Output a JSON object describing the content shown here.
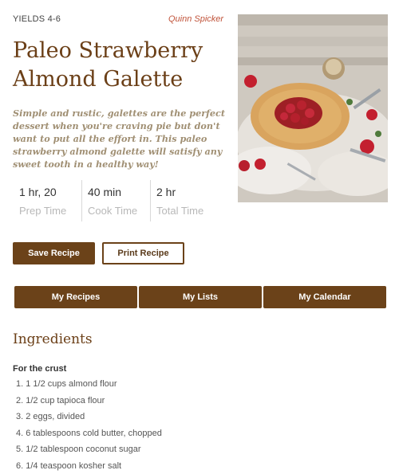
{
  "recipe": {
    "yields": "YIELDS 4-6",
    "author": "Quinn Spicker",
    "title_line1": "Paleo Strawberry",
    "title_line2": "Almond Galette",
    "description": "Simple and rustic, galettes are the perfect dessert when you're craving pie but don't want to put all the effort in. This paleo strawberry almond galette will satisfy any sweet tooth in a healthy way!"
  },
  "times": [
    {
      "value": "1 hr, 20",
      "label": "Prep Time"
    },
    {
      "value": "40 min",
      "label": "Cook Time"
    },
    {
      "value": "2 hr",
      "label": "Total Time"
    }
  ],
  "actions": {
    "save_label": "Save Recipe",
    "print_label": "Print Recipe"
  },
  "tabs": [
    {
      "label": "My Recipes"
    },
    {
      "label": "My Lists"
    },
    {
      "label": "My Calendar"
    }
  ],
  "ingredients": {
    "heading": "Ingredients",
    "section_title": "For the crust",
    "items": [
      "1. 1 1/2 cups almond flour",
      "2. 1/2 cup tapioca flour",
      "3. 2 eggs, divided",
      "4. 6 tablespoons cold butter, chopped",
      "5. 1/2 tablespoon coconut sugar",
      "6. 1/4 teaspoon kosher salt"
    ]
  },
  "colors": {
    "brand_brown": "#6b4219",
    "title_brown": "#6b3f17",
    "author_accent": "#c0533a",
    "description_tan": "#a08f73",
    "muted_label": "#b8b8b8"
  }
}
